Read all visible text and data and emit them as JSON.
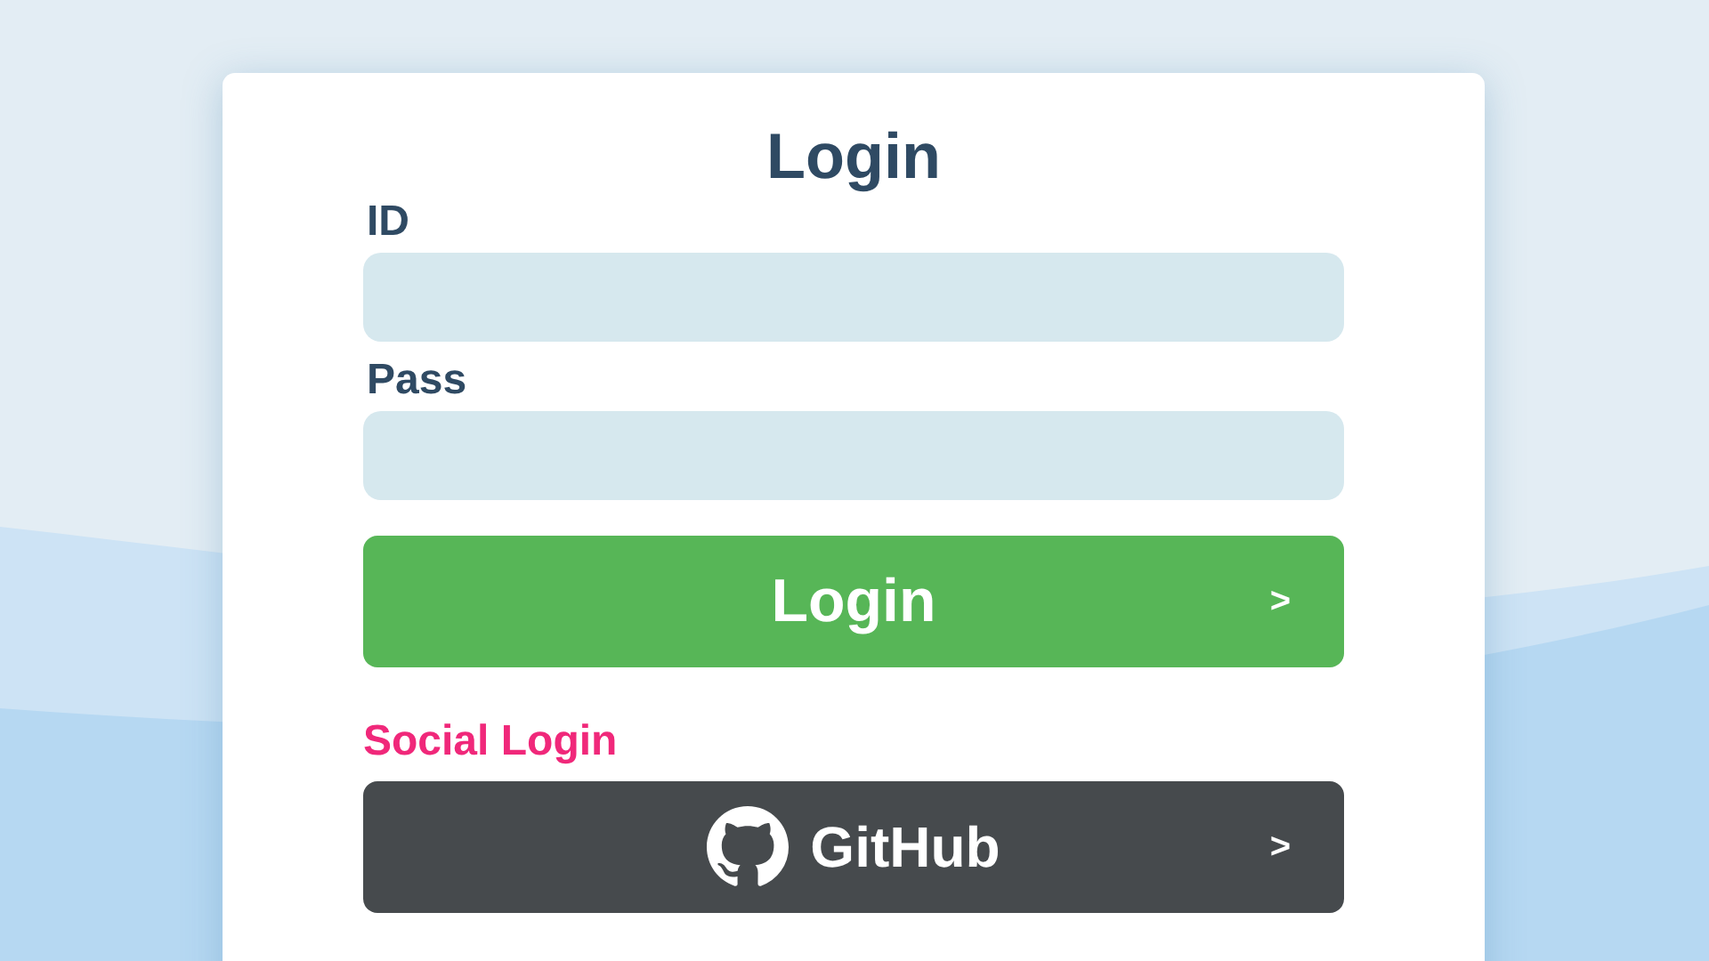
{
  "title": "Login",
  "fields": [
    {
      "label": "ID"
    },
    {
      "label": "Pass"
    }
  ],
  "login_button": {
    "label": "Login",
    "arrow": ">"
  },
  "social_heading": "Social Login",
  "social_buttons": [
    {
      "kind": "github",
      "label": "GitHub",
      "arrow": ">"
    }
  ]
}
